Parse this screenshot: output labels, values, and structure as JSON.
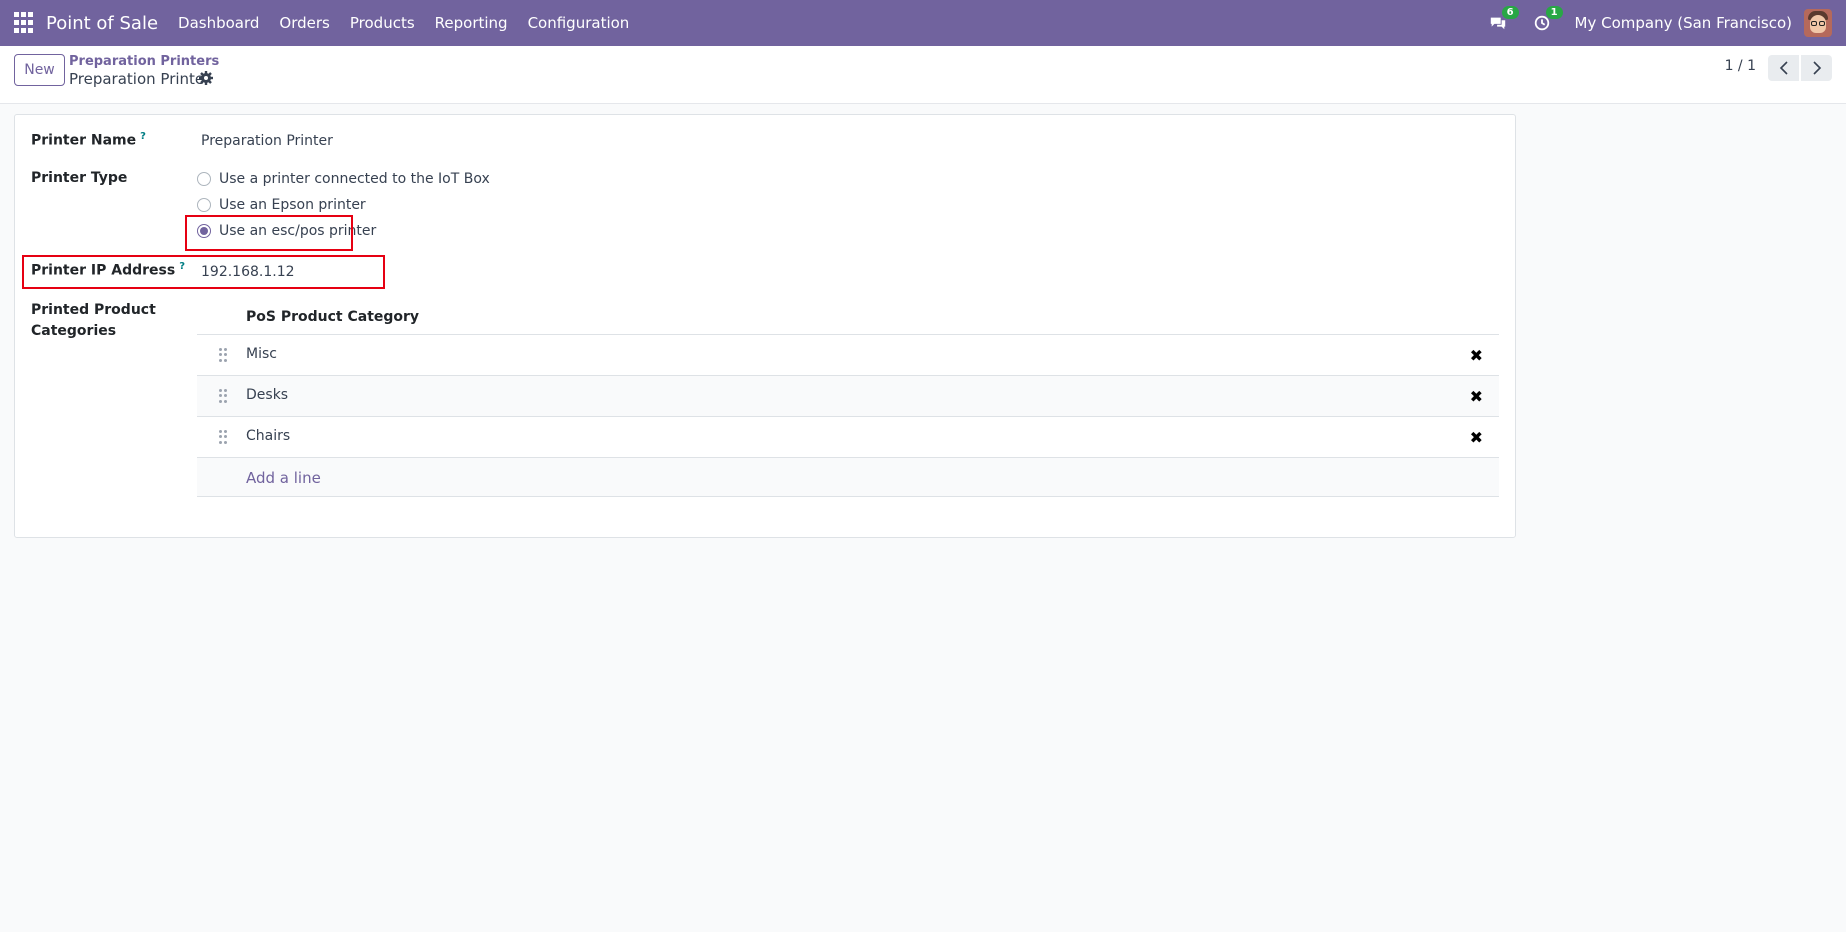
{
  "navbar": {
    "app_name": "Point of Sale",
    "menu": [
      "Dashboard",
      "Orders",
      "Products",
      "Reporting",
      "Configuration"
    ],
    "messages_count": "6",
    "activities_count": "1",
    "company": "My Company (San Francisco)",
    "color": "#71639e"
  },
  "control": {
    "new_label": "New",
    "breadcrumb_parent": "Preparation Printers",
    "breadcrumb_current": "Preparation Printer",
    "pager": "1 / 1"
  },
  "form": {
    "printer_name_label": "Printer Name",
    "printer_name_value": "Preparation Printer",
    "printer_type_label": "Printer Type",
    "printer_type_options": [
      "Use a printer connected to the IoT Box",
      "Use an Epson printer",
      "Use an esc/pos printer"
    ],
    "printer_type_selected": "Use an esc/pos printer",
    "ip_label": "Printer IP Address",
    "ip_value": "192.168.1.12",
    "categories_label_line1": "Printed Product",
    "categories_label_line2": "Categories",
    "help_mark": "?",
    "table_header": "PoS Product Category",
    "categories": [
      "Misc",
      "Desks",
      "Chairs"
    ],
    "add_line": "Add a line",
    "delete_glyph": "✖"
  },
  "highlight_color": "#e60012"
}
